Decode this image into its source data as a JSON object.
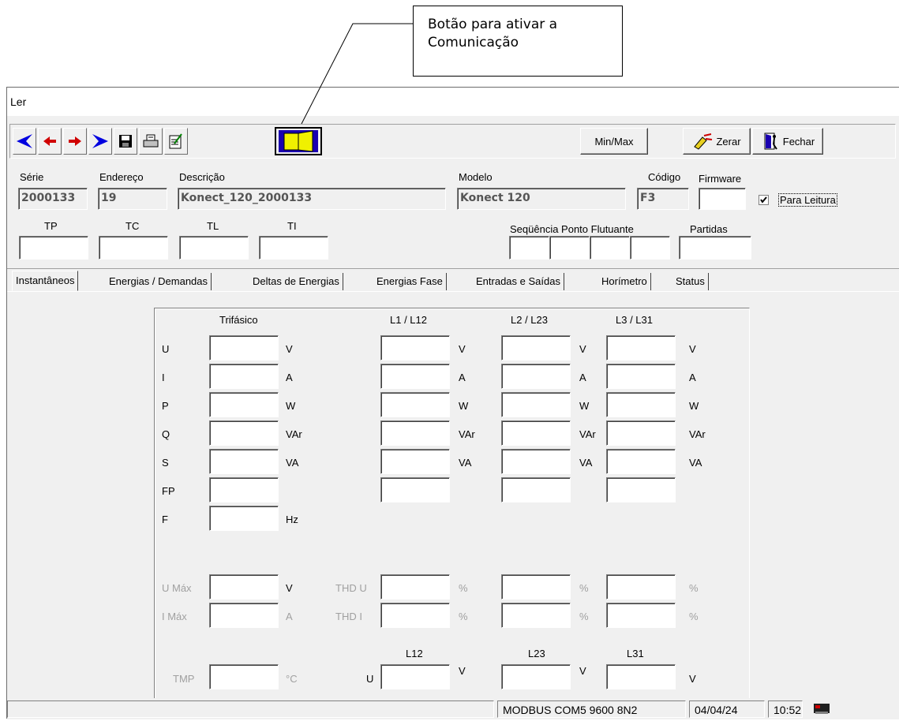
{
  "callout": {
    "text_line1": "Botão para ativar a",
    "text_line2": "Comunicação"
  },
  "window": {
    "title": "Ler"
  },
  "toolbar": {
    "first_icon": "first-record-icon",
    "prev_icon": "previous-record-icon",
    "next_icon": "next-record-icon",
    "last_icon": "last-record-icon",
    "save_icon": "save-icon",
    "print_icon": "print-icon",
    "edit_icon": "edit-notes-icon",
    "comm_icon": "open-door-icon",
    "minmax_label": "Min/Max",
    "zerar_label": "Zerar",
    "fechar_label": "Fechar"
  },
  "header": {
    "serie_label": "Série",
    "serie_value": "2000133",
    "endereco_label": "Endereço",
    "endereco_value": "19",
    "descricao_label": "Descrição",
    "descricao_value": "Konect_120_2000133",
    "modelo_label": "Modelo",
    "modelo_value": "Konect 120",
    "codigo_label": "Código",
    "codigo_value": "F3",
    "firmware_label": "Firmware",
    "firmware_value": "",
    "para_leitura_label": "Para Leitura",
    "para_leitura_checked": true,
    "tp_label": "TP",
    "tc_label": "TC",
    "tl_label": "TL",
    "ti_label": "TI",
    "sequencia_label": "Seqüência Ponto Flutuante",
    "partidas_label": "Partidas"
  },
  "tabs": [
    "Instantâneos",
    "Energias / Demandas",
    "Deltas de Energias",
    "Energias Fase",
    "Entradas e Saídas",
    "Horímetro",
    "Status"
  ],
  "grid": {
    "col_trifasico": "Trifásico",
    "col_l1": "L1 / L12",
    "col_l2": "L2 / L23",
    "col_l3": "L3 / L31",
    "rows": [
      {
        "label": "U",
        "unit": "V"
      },
      {
        "label": "I",
        "unit": "A"
      },
      {
        "label": "P",
        "unit": "W"
      },
      {
        "label": "Q",
        "unit": "VAr"
      },
      {
        "label": "S",
        "unit": "VA"
      },
      {
        "label": "FP",
        "unit": ""
      },
      {
        "label": "F",
        "unit": "Hz"
      }
    ],
    "umax_label": "U Máx",
    "umax_unit": "V",
    "imax_label": "I Máx",
    "imax_unit": "A",
    "thdu_label": "THD U",
    "thdi_label": "THD I",
    "percent": "%",
    "l12": "L12",
    "l23": "L23",
    "l31": "L31",
    "u_label": "U",
    "v_unit": "V",
    "tmp_label": "TMP",
    "tmp_unit": "°C"
  },
  "status": {
    "connection": "MODBUS COM5 9600 8N2",
    "date": "04/04/24",
    "time": "10:52",
    "device_icon": "serial-device-icon"
  }
}
